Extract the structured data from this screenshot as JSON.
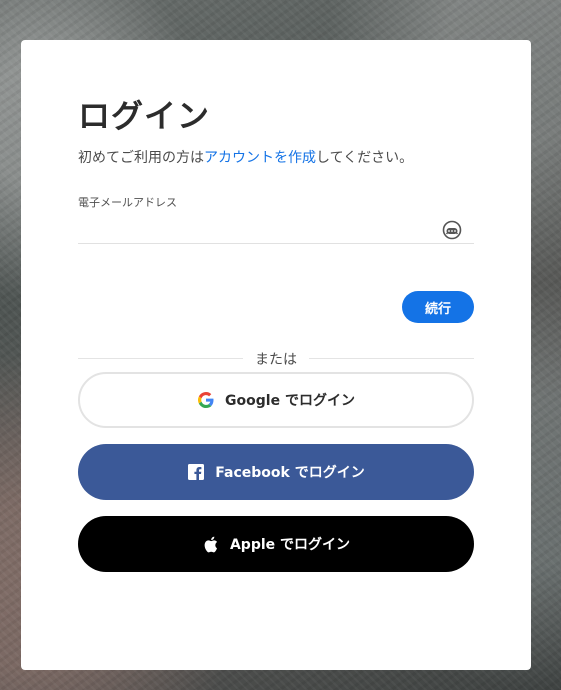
{
  "page": {
    "title": "ログイン",
    "subtitle_prefix": "初めてご利用の方は",
    "subtitle_link": "アカウントを作成",
    "subtitle_suffix": "してください。"
  },
  "email": {
    "label": "電子メールアドレス",
    "value": "",
    "icon": "password-manager-icon"
  },
  "continue_button": {
    "label": "続行",
    "color": "#1473e6"
  },
  "divider_text": "または",
  "social": {
    "google": {
      "label": "Google でログイン",
      "icon": "google-icon"
    },
    "facebook": {
      "label": "Facebook でログイン",
      "icon": "facebook-icon",
      "color": "#3b5998"
    },
    "apple": {
      "label": "Apple でログイン",
      "icon": "apple-icon",
      "color": "#000000"
    }
  }
}
